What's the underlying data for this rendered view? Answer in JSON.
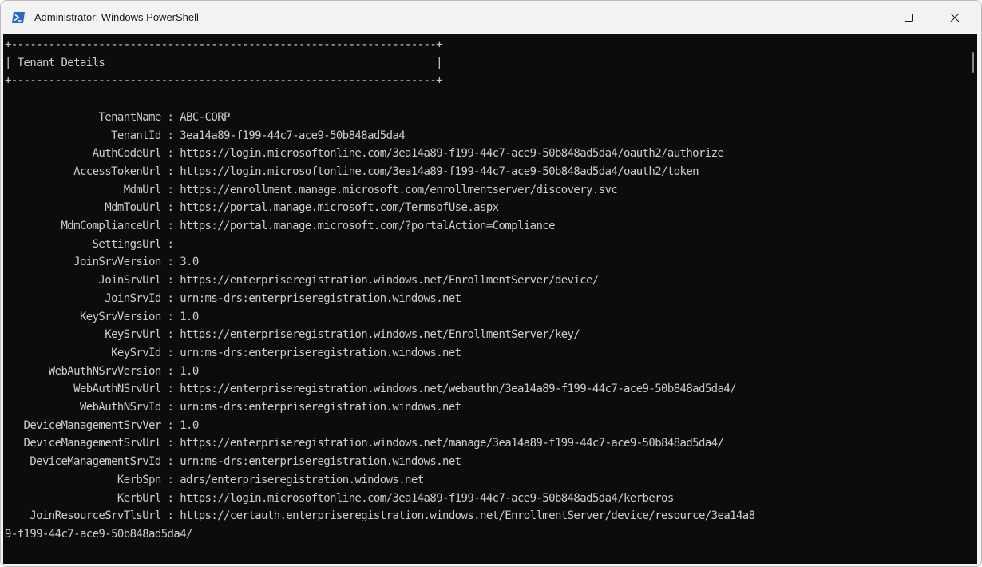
{
  "window": {
    "title": "Administrator: Windows PowerShell",
    "controls": {
      "minimize": "minimize-icon",
      "maximize": "maximize-icon",
      "close": "close-icon"
    },
    "colors": {
      "titlebar": "#f3f3f3",
      "console_bg": "#0c0c0c",
      "console_fg": "#cccccc",
      "ps_blue": "#2a6ac8"
    }
  },
  "console": {
    "box_border": "+--------------------------------------------------------------------+",
    "box_title": "| Tenant Details                                                     |",
    "fields": [
      {
        "key": "TenantName",
        "value": "ABC-CORP"
      },
      {
        "key": "TenantId",
        "value": "3ea14a89-f199-44c7-ace9-50b848ad5da4"
      },
      {
        "key": "AuthCodeUrl",
        "value": "https://login.microsoftonline.com/3ea14a89-f199-44c7-ace9-50b848ad5da4/oauth2/authorize"
      },
      {
        "key": "AccessTokenUrl",
        "value": "https://login.microsoftonline.com/3ea14a89-f199-44c7-ace9-50b848ad5da4/oauth2/token"
      },
      {
        "key": "MdmUrl",
        "value": "https://enrollment.manage.microsoft.com/enrollmentserver/discovery.svc"
      },
      {
        "key": "MdmTouUrl",
        "value": "https://portal.manage.microsoft.com/TermsofUse.aspx"
      },
      {
        "key": "MdmComplianceUrl",
        "value": "https://portal.manage.microsoft.com/?portalAction=Compliance"
      },
      {
        "key": "SettingsUrl",
        "value": ""
      },
      {
        "key": "JoinSrvVersion",
        "value": "3.0"
      },
      {
        "key": "JoinSrvUrl",
        "value": "https://enterpriseregistration.windows.net/EnrollmentServer/device/"
      },
      {
        "key": "JoinSrvId",
        "value": "urn:ms-drs:enterpriseregistration.windows.net"
      },
      {
        "key": "KeySrvVersion",
        "value": "1.0"
      },
      {
        "key": "KeySrvUrl",
        "value": "https://enterpriseregistration.windows.net/EnrollmentServer/key/"
      },
      {
        "key": "KeySrvId",
        "value": "urn:ms-drs:enterpriseregistration.windows.net"
      },
      {
        "key": "WebAuthNSrvVersion",
        "value": "1.0"
      },
      {
        "key": "WebAuthNSrvUrl",
        "value": "https://enterpriseregistration.windows.net/webauthn/3ea14a89-f199-44c7-ace9-50b848ad5da4/"
      },
      {
        "key": "WebAuthNSrvId",
        "value": "urn:ms-drs:enterpriseregistration.windows.net"
      },
      {
        "key": "DeviceManagementSrvVer",
        "value": "1.0"
      },
      {
        "key": "DeviceManagementSrvUrl",
        "value": "https://enterpriseregistration.windows.net/manage/3ea14a89-f199-44c7-ace9-50b848ad5da4/"
      },
      {
        "key": "DeviceManagementSrvId",
        "value": "urn:ms-drs:enterpriseregistration.windows.net"
      },
      {
        "key": "KerbSpn",
        "value": "adrs/enterpriseregistration.windows.net"
      },
      {
        "key": "KerbUrl",
        "value": "https://login.microsoftonline.com/3ea14a89-f199-44c7-ace9-50b848ad5da4/kerberos"
      },
      {
        "key": "JoinResourceSrvTlsUrl",
        "value": "https://certauth.enterpriseregistration.windows.net/EnrollmentServer/device/resource/3ea14a89-f199-44c7-ace9-50b848ad5da4/"
      }
    ]
  }
}
